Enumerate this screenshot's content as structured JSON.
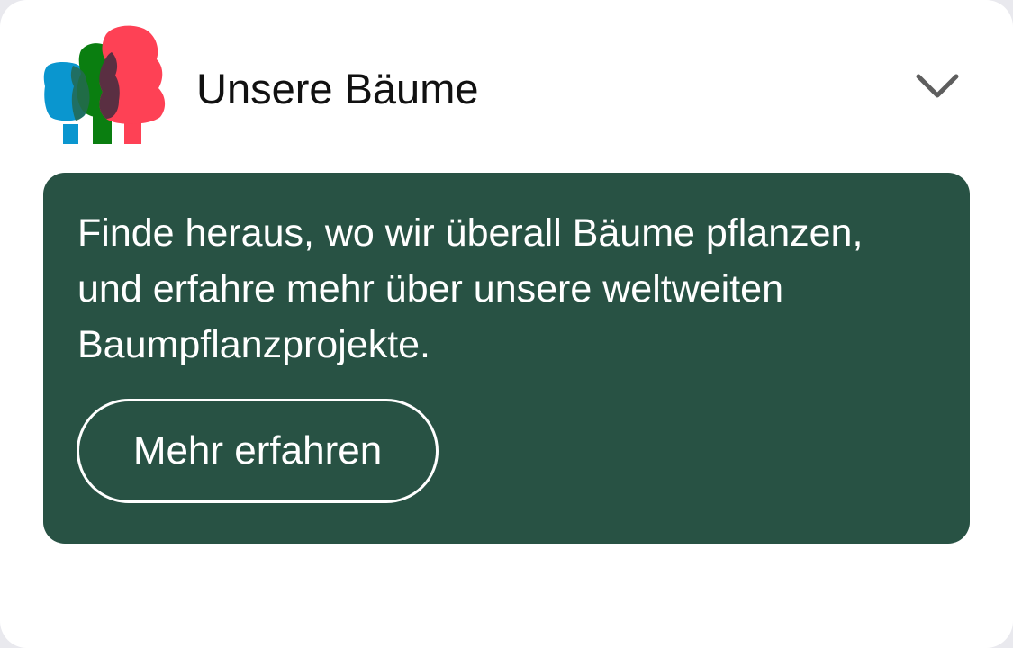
{
  "header": {
    "title": "Unsere Bäume",
    "logo_icon": "trees-logo-icon",
    "toggle_icon": "chevron-down-icon"
  },
  "panel": {
    "description": "Finde heraus, wo wir überall Bäume pflanzen, und erfahre mehr über unsere weltweiten Baumpflanzprojekte.",
    "cta_label": "Mehr erfahren"
  },
  "colors": {
    "panel_background": "#285244",
    "tree_blue": "#0a96cf",
    "tree_green": "#0a7e10",
    "tree_red": "#fe4155",
    "chevron": "#5e5e5e"
  }
}
